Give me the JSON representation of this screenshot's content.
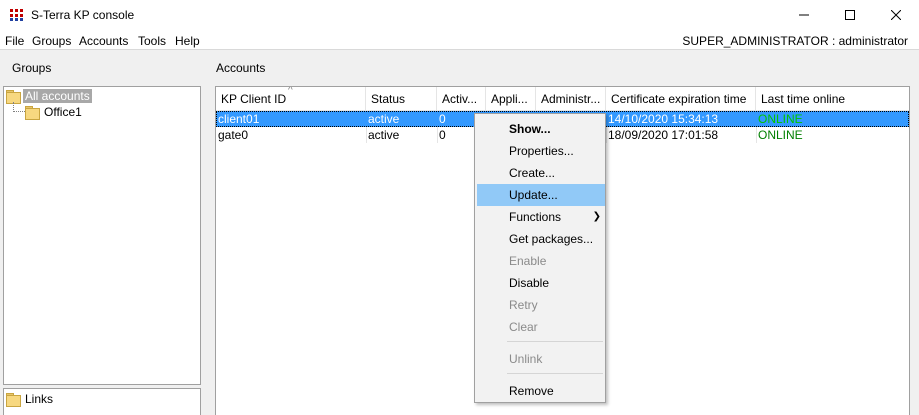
{
  "window": {
    "title": "S-Terra KP console"
  },
  "menubar": {
    "items": [
      "File",
      "Groups",
      "Accounts",
      "Tools",
      "Help"
    ],
    "user": "SUPER_ADMINISTRATOR : administrator"
  },
  "groups_panel": {
    "label": "Groups",
    "tree": [
      {
        "label": "All accounts",
        "selected": true
      },
      {
        "label": "Office1",
        "selected": false
      }
    ]
  },
  "links_panel": {
    "label": "Links"
  },
  "accounts_panel": {
    "label": "Accounts",
    "columns": [
      "KP Client ID",
      "Status",
      "Activ...",
      "Appli...",
      "Administr...",
      "Certificate expiration time",
      "Last time online"
    ],
    "rows": [
      {
        "id": "client01",
        "status": "active",
        "active": "0",
        "cert": "14/10/2020 15:34:13",
        "online": "ONLINE",
        "selected": true
      },
      {
        "id": "gate0",
        "status": "active",
        "active": "0",
        "cert": "18/09/2020 17:01:58",
        "online": "ONLINE",
        "selected": false
      }
    ]
  },
  "context_menu": {
    "items": [
      {
        "label": "Show...",
        "bold": true
      },
      {
        "label": "Properties..."
      },
      {
        "label": "Create..."
      },
      {
        "label": "Update...",
        "hover": true
      },
      {
        "label": "Functions",
        "submenu": true
      },
      {
        "label": "Get packages..."
      },
      {
        "label": "Enable",
        "disabled": true
      },
      {
        "label": "Disable"
      },
      {
        "label": "Retry",
        "disabled": true
      },
      {
        "label": "Clear",
        "disabled": true
      },
      {
        "label": "Unlink",
        "disabled": true
      },
      {
        "label": "Remove"
      }
    ]
  },
  "colors": {
    "selection": "#3399ff",
    "online": "#008000",
    "menu_hover": "#91c9f7"
  }
}
